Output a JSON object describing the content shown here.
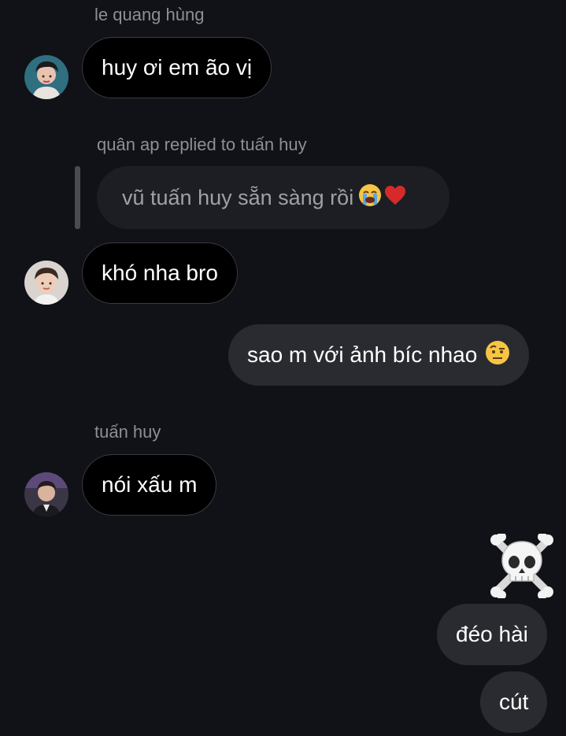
{
  "messages": [
    {
      "sender": "le quang hùng",
      "text": "huy ơi em ão vị",
      "avatar_icon": "user-avatar-icon"
    },
    {
      "reply_header": "quân ap replied to tuấn huy",
      "quoted_text": "vũ tuấn huy sẵn sàng rồi",
      "quoted_emoji": [
        "loudly-crying-face-emoji",
        "red-heart-emoji"
      ],
      "text": "khó nha bro",
      "avatar_icon": "user-avatar-icon"
    },
    {
      "outgoing": true,
      "text": "sao m với ảnh bíc nhao",
      "emoji": "face-with-raised-eyebrow-emoji"
    },
    {
      "sender": "tuấn huy",
      "text": "nói xấu m",
      "avatar_icon": "user-avatar-icon"
    },
    {
      "outgoing": true,
      "emoji_only": "skull-and-crossbones-emoji"
    },
    {
      "outgoing": true,
      "text": "đéo hài"
    },
    {
      "outgoing": true,
      "text": "cút"
    }
  ],
  "colors": {
    "background": "#111217",
    "incoming_bubble": "#000000",
    "incoming_border": "#3a3b42",
    "outgoing_bubble": "#2a2b30",
    "reply_quote_bubble": "#1d1e23",
    "meta_text": "#8e8e93"
  }
}
